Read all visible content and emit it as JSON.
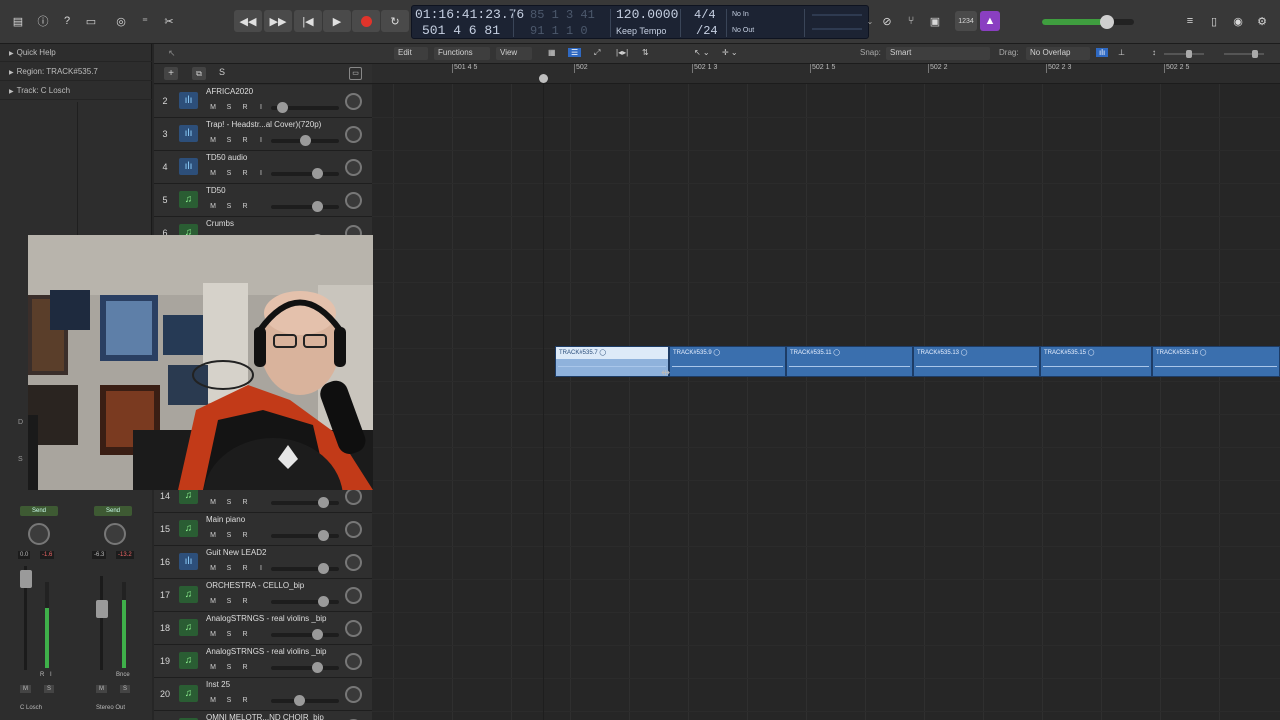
{
  "control_bar": {
    "transport": {
      "icons": [
        "rewind-icon",
        "fast-forward-icon",
        "go-to-start-icon",
        "play-icon",
        "record-icon",
        "cycle-icon"
      ]
    },
    "lcd": {
      "time": "01:16:41:23.76",
      "bars": "501  4  6  81",
      "dim_top": "85  1  3  41",
      "dim_bottom": "91  1  1  0",
      "tempo": "120.0000",
      "tempo_label": "Keep Tempo",
      "signature": "4/4",
      "division": "/24",
      "in": "No In",
      "out": "No Out"
    },
    "count_in_badge": "1234"
  },
  "inspector": {
    "rows": [
      "Quick Help",
      "Region: TRACK#535.7",
      "Track:  C Losch"
    ]
  },
  "edit_bar": {
    "edit": "Edit",
    "functions": "Functions",
    "view": "View",
    "snap_label": "Snap:",
    "snap_value": "Smart",
    "drag_label": "Drag:",
    "drag_value": "No Overlap"
  },
  "ruler": [
    "501 4 5",
    "502",
    "502 1 3",
    "502 1 5",
    "502 2",
    "502 2 3",
    "502 2 5"
  ],
  "tracks_top": [
    {
      "num": "2",
      "type": "audio",
      "name": "AFRICA2020",
      "rec": true,
      "fader": 0.1
    },
    {
      "num": "3",
      "type": "audio",
      "name": "Trap! - Headstr...al Cover)(720p)",
      "rec": true,
      "fader": 0.48
    },
    {
      "num": "4",
      "type": "audio",
      "name": "TD50 audio",
      "rec": true,
      "fader": 0.68
    },
    {
      "num": "5",
      "type": "midi",
      "name": "TD50",
      "rec": false,
      "fader": 0.68
    },
    {
      "num": "6",
      "type": "midi",
      "name": "Crumbs",
      "rec": false,
      "fader": 0.68
    }
  ],
  "tracks_bottom": [
    {
      "num": "14",
      "type": "midi",
      "name": "",
      "rec": false,
      "fader": 0.78
    },
    {
      "num": "15",
      "type": "midi",
      "name": "Main piano",
      "rec": false,
      "fader": 0.78
    },
    {
      "num": "16",
      "type": "audio",
      "name": "Guit New LEAD2",
      "rec": true,
      "fader": 0.78
    },
    {
      "num": "17",
      "type": "midi",
      "name": "ORCHESTRA - CELLO_bip",
      "rec": false,
      "fader": 0.78
    },
    {
      "num": "18",
      "type": "midi",
      "name": "AnalogSTRNGS - real violins _bip",
      "rec": false,
      "fader": 0.68
    },
    {
      "num": "19",
      "type": "midi",
      "name": "AnalogSTRNGS - real violins _bip",
      "rec": false,
      "fader": 0.68
    },
    {
      "num": "20",
      "type": "midi",
      "name": "Inst 25",
      "rec": false,
      "fader": 0.38
    },
    {
      "num": "21",
      "type": "midi",
      "name": "OMNI MELOTR...ND CHOIR_bip",
      "rec": false,
      "fader": 0.5
    }
  ],
  "track_buttons": {
    "m": "M",
    "s": "S",
    "r": "R",
    "i": "I"
  },
  "regions": [
    "TRACK#535.7",
    "TRACK#535.9",
    "TRACK#535.11",
    "TRACK#535.13",
    "TRACK#535.15",
    "TRACK#535.16"
  ],
  "channel_strips": {
    "left": {
      "setting": "Send",
      "vol": "0.0",
      "peak": "-1.6",
      "name": "C Losch"
    },
    "right": {
      "setting": "Send",
      "vol": "-6.3",
      "peak": "-13.2",
      "name": "Stereo Out",
      "bounce": "Bnce"
    },
    "mute": "M",
    "solo": "S",
    "r": "R",
    "i": "I"
  },
  "colors": {
    "region": "#3a6fae",
    "lcd_bg": "#1c2333",
    "audio_icon": "#2d4f7a",
    "midi_icon": "#2a5d33",
    "record": "#e0342b",
    "badge": "#8a3fc1"
  }
}
